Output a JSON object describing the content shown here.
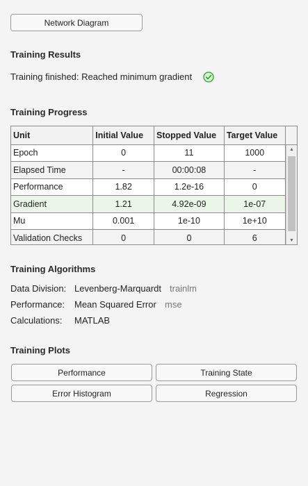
{
  "buttons": {
    "network_diagram": "Network Diagram",
    "performance": "Performance",
    "training_state": "Training State",
    "error_histogram": "Error Histogram",
    "regression": "Regression"
  },
  "results": {
    "title": "Training Results",
    "status": "Training finished: Reached minimum gradient",
    "status_icon": "check-circle-icon",
    "status_color": "#2aa22a"
  },
  "progress": {
    "title": "Training Progress",
    "headers": [
      "Unit",
      "Initial Value",
      "Stopped Value",
      "Target Value"
    ],
    "rows": [
      {
        "unit": "Epoch",
        "initial": "0",
        "stopped": "11",
        "target": "1000"
      },
      {
        "unit": "Elapsed Time",
        "initial": "-",
        "stopped": "00:00:08",
        "target": "-"
      },
      {
        "unit": "Performance",
        "initial": "1.82",
        "stopped": "1.2e-16",
        "target": "0"
      },
      {
        "unit": "Gradient",
        "initial": "1.21",
        "stopped": "4.92e-09",
        "target": "1e-07"
      },
      {
        "unit": "Mu",
        "initial": "0.001",
        "stopped": "1e-10",
        "target": "1e+10"
      },
      {
        "unit": "Validation Checks",
        "initial": "0",
        "stopped": "0",
        "target": "6"
      }
    ],
    "highlight_color": "#ebf6e8"
  },
  "algorithms": {
    "title": "Training Algorithms",
    "data_division_label": "Data Division:",
    "data_division_value": "Levenberg-Marquardt",
    "data_division_code": "trainlm",
    "performance_label": "Performance:",
    "performance_value": "Mean Squared Error",
    "performance_code": "mse",
    "calculations_label": "Calculations:",
    "calculations_value": "MATLAB"
  },
  "plots": {
    "title": "Training Plots"
  }
}
